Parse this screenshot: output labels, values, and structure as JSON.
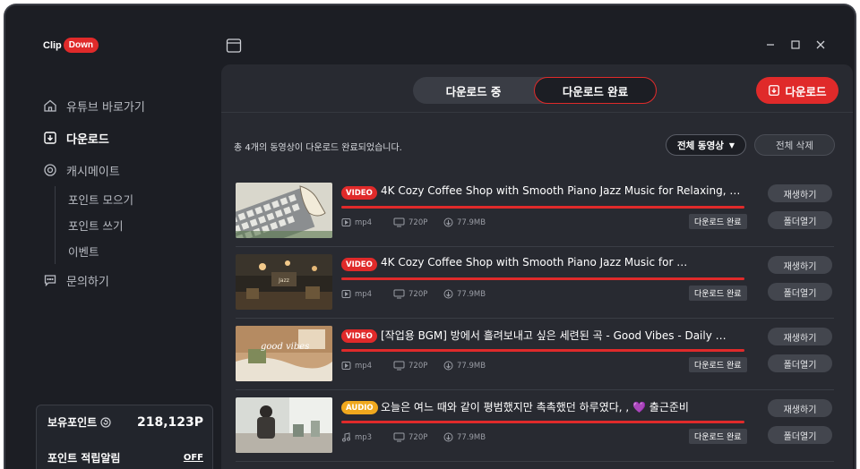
{
  "brand": {
    "clip": "Clip",
    "down": "Down",
    "accent": "#e02a2a"
  },
  "sidebar": {
    "items": [
      {
        "label": "유튜브 바로가기",
        "icon": "home-icon"
      },
      {
        "label": "다운로드",
        "icon": "download-icon",
        "active": true
      },
      {
        "label": "캐시메이트",
        "icon": "coin-icon"
      },
      {
        "label": "문의하기",
        "icon": "chat-icon"
      }
    ],
    "sub_items": [
      "포인트 모으기",
      "포인트 쓰기",
      "이벤트"
    ],
    "points": {
      "label": "보유포인트",
      "value": "218,123P"
    },
    "alarm": {
      "label": "포인트 적립알림",
      "state": "OFF"
    }
  },
  "tabs": {
    "downloading": "다운로드 중",
    "completed": "다운로드 완료"
  },
  "download_button": "다운로드",
  "summary": "총 4개의 동영상이 다운로드 완료되었습니다.",
  "filter": "전체 동영상",
  "delete_all": "전체 삭제",
  "actions": {
    "play": "재생하기",
    "folder": "폴더열기"
  },
  "videos": [
    {
      "badge": "VIDEO",
      "title": "4K Cozy Coffee Shop with Smooth Piano Jazz Music for Relaxing, …",
      "format": "mp4",
      "quality": "720P",
      "size": "77.9MB",
      "status": "다운로드 완료",
      "progress": 1.0
    },
    {
      "badge": "VIDEO",
      "title": "4K Cozy Coffee Shop with Smooth Piano Jazz Music for …",
      "format": "mp4",
      "quality": "720P",
      "size": "77.9MB",
      "status": "다운로드 완료",
      "progress": 1.0
    },
    {
      "badge": "VIDEO",
      "title": "[작업용 BGM] 방에서 흘려보내고 싶은 세련된 곡 - Good Vibes - Daily …",
      "format": "mp4",
      "quality": "720P",
      "size": "77.9MB",
      "status": "다운로드 완료",
      "progress": 1.0
    },
    {
      "badge": "AUDIO",
      "title": "오늘은 여느 때와 같이 평범했지만 촉촉했던 하루였다, , 💜 출근준비",
      "format": "mp3",
      "quality": "720P",
      "size": "77.9MB",
      "status": "다운로드 완료",
      "progress": 1.0
    }
  ]
}
